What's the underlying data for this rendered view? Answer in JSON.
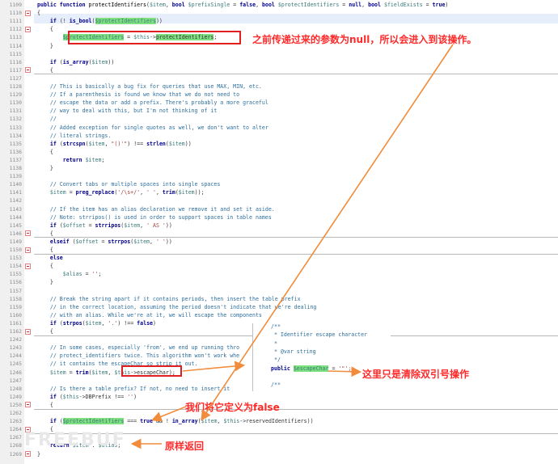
{
  "editor": {
    "lines": [
      {
        "n": "1109",
        "html": "<span class='kw'>public function</span> <span class='fn'>protectIdentifiers</span>(<span class='vr'>$item</span>, <span class='kw'>bool</span> <span class='vr'>$prefixSingle</span> = <span class='kw'>false</span>, <span class='kw'>bool</span> <span class='vr'>$protectIdentifiers</span> = <span class='kw'>null</span>, <span class='kw'>bool</span> <span class='vr'>$fieldExists</span> = <span class='kw'>true</span>)"
      },
      {
        "n": "1110",
        "html": "{"
      },
      {
        "n": "1111",
        "html": "    <span class='kw'>if</span> (! <span class='kw'>is_bool</span>(<span class='vr hl'>$protectIdentifiers</span>))"
      },
      {
        "n": "1112",
        "html": "    {"
      },
      {
        "n": "1113",
        "html": "        <span class='vr hl'>$protectIdentifiers</span> = <span class='vr'>$this</span>-><span class='hl'>protectIdentifiers</span>;"
      },
      {
        "n": "1114",
        "html": "    }"
      },
      {
        "n": "1115",
        "html": ""
      },
      {
        "n": "1116",
        "html": "    <span class='kw'>if</span> (<span class='kw'>is_array</span>(<span class='vr'>$item</span>))"
      },
      {
        "n": "1117",
        "html": "    {"
      },
      {
        "n": "1127",
        "html": ""
      },
      {
        "n": "1128",
        "html": "    <span class='cm'>// This is basically a bug fix for queries that use MAX, MIN, etc.</span>"
      },
      {
        "n": "1129",
        "html": "    <span class='cm'>// If a parenthesis is found we know that we do not need to</span>"
      },
      {
        "n": "1130",
        "html": "    <span class='cm'>// escape the data or add a prefix. There's probably a more graceful</span>"
      },
      {
        "n": "1131",
        "html": "    <span class='cm'>// way to deal with this, but I'm not thinking of it</span>"
      },
      {
        "n": "1132",
        "html": "    <span class='cm'>//</span>"
      },
      {
        "n": "1133",
        "html": "    <span class='cm'>// Added exception for single quotes as well, we don't want to alter</span>"
      },
      {
        "n": "1134",
        "html": "    <span class='cm'>// literal strings.</span>"
      },
      {
        "n": "1135",
        "html": "    <span class='kw'>if</span> (<span class='kw'>strcspn</span>(<span class='vr'>$item</span>, <span class='st'>\"()'\"</span>) !== <span class='kw'>strlen</span>(<span class='vr'>$item</span>))"
      },
      {
        "n": "1136",
        "html": "    {"
      },
      {
        "n": "1137",
        "html": "        <span class='kw'>return</span> <span class='vr'>$item</span>;"
      },
      {
        "n": "1138",
        "html": "    }"
      },
      {
        "n": "1139",
        "html": ""
      },
      {
        "n": "1140",
        "html": "    <span class='cm'>// Convert tabs or multiple spaces into single spaces</span>"
      },
      {
        "n": "1141",
        "html": "    <span class='vr'>$item</span> = <span class='kw'>preg_replace</span>(<span class='st'>'/\\s+/'</span>, <span class='st'>' '</span>, <span class='kw'>trim</span>(<span class='vr'>$item</span>));"
      },
      {
        "n": "1142",
        "html": ""
      },
      {
        "n": "1143",
        "html": "    <span class='cm'>// If the item has an alias declaration we remove it and set it aside.</span>"
      },
      {
        "n": "1144",
        "html": "    <span class='cm'>// Note: strripos() is used in order to support spaces in table names</span>"
      },
      {
        "n": "1145",
        "html": "    <span class='kw'>if</span> (<span class='vr'>$offset</span> = <span class='kw'>strripos</span>(<span class='vr'>$item</span>, <span class='st'>' AS '</span>))"
      },
      {
        "n": "1146",
        "html": "    {"
      },
      {
        "n": "1149",
        "html": "    <span class='kw'>elseif</span> (<span class='vr'>$offset</span> = <span class='kw'>strrpos</span>(<span class='vr'>$item</span>, <span class='st'>' '</span>))"
      },
      {
        "n": "1150",
        "html": "    {"
      },
      {
        "n": "1153",
        "html": "    <span class='kw'>else</span>"
      },
      {
        "n": "1154",
        "html": "    {"
      },
      {
        "n": "1155",
        "html": "        <span class='vr'>$alias</span> = <span class='st'>''</span>;"
      },
      {
        "n": "1156",
        "html": "    }"
      },
      {
        "n": "1157",
        "html": ""
      },
      {
        "n": "1158",
        "html": "    <span class='cm'>// Break the string apart if it contains periods, then insert the table prefix</span>"
      },
      {
        "n": "1159",
        "html": "    <span class='cm'>// in the correct location, assuming the period doesn't indicate that we're dealing</span>"
      },
      {
        "n": "1160",
        "html": "    <span class='cm'>// with an alias. While we're at it, we will escape the components</span>"
      },
      {
        "n": "1161",
        "html": "    <span class='kw'>if</span> (<span class='kw'>strpos</span>(<span class='vr'>$item</span>, <span class='st'>'.'</span>) !== <span class='kw'>false</span>)"
      },
      {
        "n": "1162",
        "html": "    {"
      },
      {
        "n": "1242",
        "html": ""
      },
      {
        "n": "1243",
        "html": "    <span class='cm'>// In some cases, especially 'from', we end up running thro</span>"
      },
      {
        "n": "1244",
        "html": "    <span class='cm'>// protect_identifiers twice. This algorithm won't work whe</span>"
      },
      {
        "n": "1245",
        "html": "    <span class='cm'>// it contains the escapeChar so strip it out.</span>"
      },
      {
        "n": "1246",
        "html": "    <span class='vr'>$item</span> = <span class='kw'>trim</span>(<span class='vr'>$item</span>, <span class='vr'>$this</span>->escapeChar);"
      },
      {
        "n": "1247",
        "html": ""
      },
      {
        "n": "1248",
        "html": "    <span class='cm'>// Is there a table prefix? If not, no need to insert it</span>"
      },
      {
        "n": "1249",
        "html": "    <span class='kw'>if</span> (<span class='vr'>$this</span>->DBPrefix !== <span class='st'>''</span>)"
      },
      {
        "n": "1250",
        "html": "    {"
      },
      {
        "n": "1262",
        "html": ""
      },
      {
        "n": "1263",
        "html": "    <span class='kw'>if</span> (<span class='vr hl'>$protectIdentifiers</span> === <span class='kw'>true</span> && ! <span class='kw'>in_array</span>(<span class='vr'>$item</span>, <span class='vr'>$this</span>->reservedIdentifiers))"
      },
      {
        "n": "1264",
        "html": "    {"
      },
      {
        "n": "1267",
        "html": ""
      },
      {
        "n": "1268",
        "html": "    <span class='kw'>return</span> <span class='vr'>$item</span> . <span class='vr'>$alias</span>;"
      },
      {
        "n": "1269",
        "html": "}"
      }
    ],
    "popup_lines": [
      "/**",
      " * Identifier escape character",
      " *",
      " * @var string",
      " */",
      "public $escapeChar = '\"';",
      "",
      "/**"
    ]
  },
  "annotations": {
    "null_note": "之前传递过来的参数为null，所以会进入到该操作。",
    "quote_note": "这里只是清除双引号操作",
    "false_note": "我们将它定义为false",
    "return_note": "原样返回"
  },
  "watermark": "FREEBUF",
  "colors": {
    "annotation_red": "#ff2a2a",
    "arrow_orange": "#f08c3c",
    "highlight_green": "#7fe07f"
  }
}
